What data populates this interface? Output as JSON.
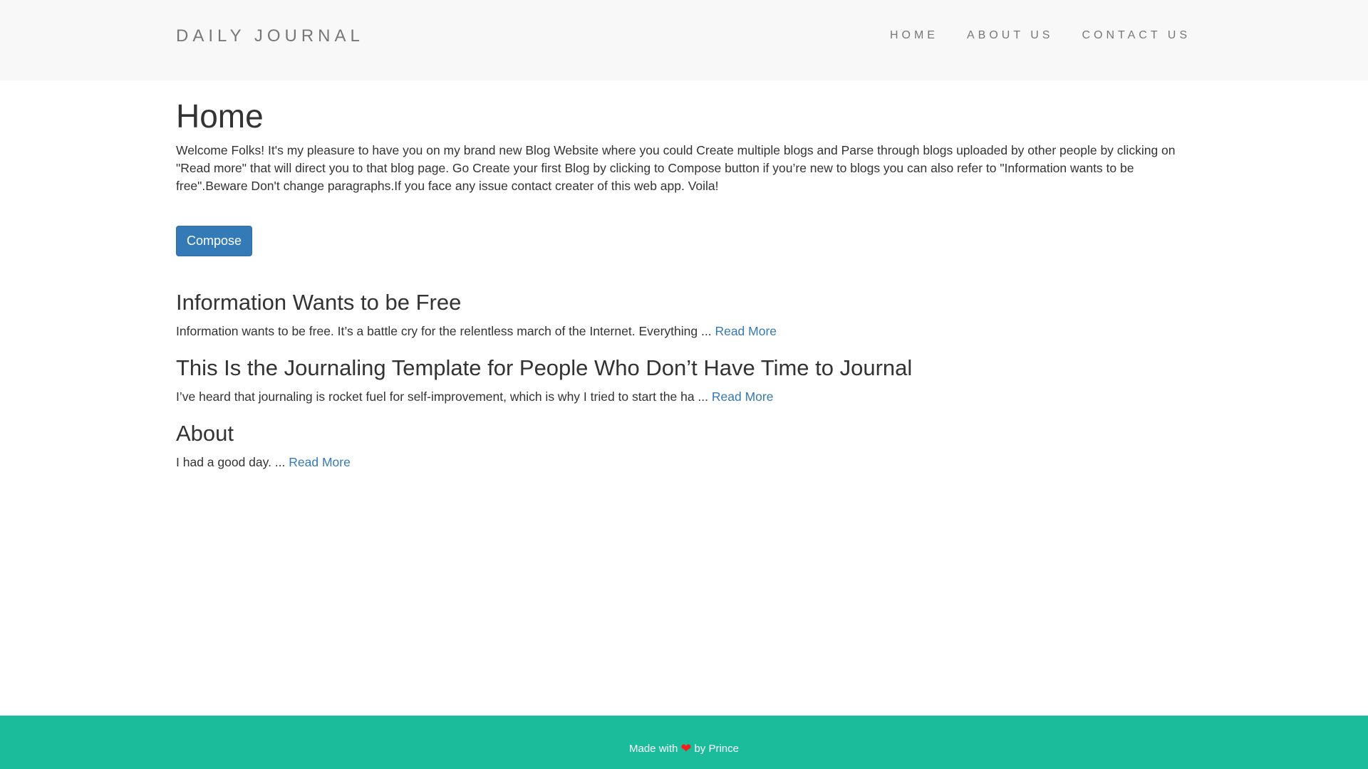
{
  "navbar": {
    "brand": "DAILY JOURNAL",
    "links": [
      {
        "label": "HOME"
      },
      {
        "label": "ABOUT US"
      },
      {
        "label": "CONTACT US"
      }
    ]
  },
  "main": {
    "title": "Home",
    "intro": "Welcome Folks! It's my pleasure to have you on my brand new Blog Website where you could Create multiple blogs and Parse through blogs uploaded by other people by clicking on \"Read more\" that will direct you to that blog page. Go Create your first Blog by clicking to Compose button if you’re new to blogs you can also refer to \"Information wants to be free\".Beware Don't change paragraphs.If you face any issue contact creater of this web app. Voila!",
    "compose_label": "Compose",
    "posts": [
      {
        "title": "Information Wants to be Free",
        "excerpt": "Information wants to be free. It’s a battle cry for the relentless march of the Internet. Everything ...",
        "read_more": "Read More"
      },
      {
        "title": "This Is the Journaling Template for People Who Don’t Have Time to Journal",
        "excerpt": "I’ve heard that journaling is rocket fuel for self-improvement, which is why I tried to start the ha ...",
        "read_more": "Read More"
      },
      {
        "title": "About",
        "excerpt": "I had a good day. ...",
        "read_more": "Read More"
      }
    ]
  },
  "footer": {
    "made_with": "Made with",
    "heart_icon": "heart-icon",
    "by": "by Prince"
  },
  "colors": {
    "navbar_bg": "#f8f8f8",
    "primary": "#337ab7",
    "footer_bg": "#1abc9c",
    "heart": "#ff1a1a"
  }
}
